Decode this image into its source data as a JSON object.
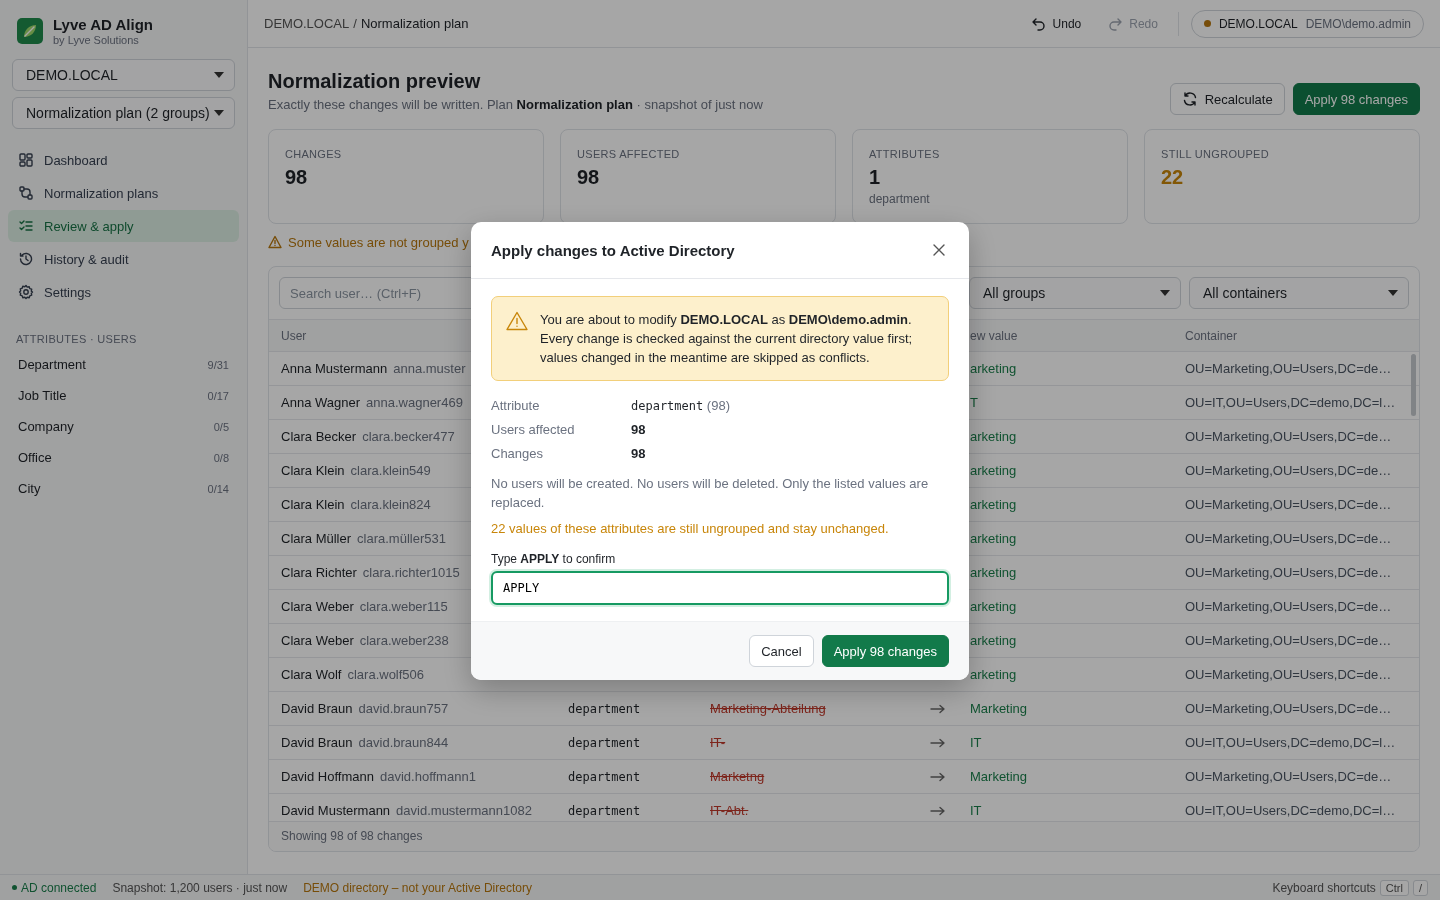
{
  "sidebar": {
    "app_name": "Lyve AD Align",
    "app_subtitle": "by Lyve Solutions",
    "domain_select": {
      "value": "DEMO.LOCAL"
    },
    "plan_select": {
      "value": "Normalization plan (2 groups)"
    },
    "nav_items": [
      {
        "label": "Dashboard",
        "selected": false
      },
      {
        "label": "Normalization plans",
        "selected": false
      },
      {
        "label": "Review & apply",
        "selected": true
      },
      {
        "label": "History & audit",
        "selected": false
      },
      {
        "label": "Settings",
        "selected": false
      }
    ],
    "section_title": "ATTRIBUTES · USERS",
    "attributes": [
      {
        "label": "Department",
        "count": "9/31"
      },
      {
        "label": "Job Title",
        "count": "0/17"
      },
      {
        "label": "Company",
        "count": "0/5"
      },
      {
        "label": "Office",
        "count": "0/8"
      },
      {
        "label": "City",
        "count": "0/14"
      }
    ]
  },
  "topbar": {
    "breadcrumb": [
      {
        "label": "DEMO.LOCAL"
      },
      {
        "label": "Normalization plan"
      }
    ],
    "separator": "/",
    "undo": {
      "label": "Undo",
      "disabled": false
    },
    "redo": {
      "label": "Redo",
      "disabled": true
    },
    "connection": {
      "color": "#774d09",
      "domain": "DEMO.LOCAL",
      "user": "DEMO\\demo.admin"
    }
  },
  "page": {
    "title": "Normalization preview",
    "subtitle": "Exactly these changes will be written. Plan **Normalization plan** · snapshot of just now",
    "buttons": [
      {
        "label": "Recalculate",
        "kind": "secondary"
      },
      {
        "label": "Apply 98 changes",
        "kind": "primary"
      }
    ]
  },
  "stats": [
    {
      "label": "CHANGES",
      "value": "98",
      "kind": "default"
    },
    {
      "label": "USERS AFFECTED",
      "value": "98",
      "kind": "default"
    },
    {
      "label": "ATTRIBUTES",
      "value": "1",
      "kind": "default",
      "note": "department"
    },
    {
      "label": "STILL UNGROUPED",
      "value": "22",
      "kind": "warning"
    }
  ],
  "warning_line": "Some values are not grouped y",
  "table": {
    "search": {
      "placeholder": "Search user… (Ctrl+F)"
    },
    "filters": [
      {
        "value": "All groups"
      },
      {
        "value": "All containers"
      }
    ],
    "columns": [
      {
        "label": "User",
        "kind": "user"
      },
      {
        "label": "ew value",
        "kind": "new"
      },
      {
        "label": "Container",
        "kind": "container"
      }
    ],
    "rows": [
      {
        "name": "Anna Mustermann",
        "login": "anna.muster",
        "new_value": "arketing",
        "container": "OU=Marketing,OU=Users,DC=de…"
      },
      {
        "name": "Anna Wagner",
        "login": "anna.wagner469",
        "new_value": "T",
        "container": "OU=IT,OU=Users,DC=demo,DC=l…"
      },
      {
        "name": "Clara Becker",
        "login": "clara.becker477",
        "new_value": "arketing",
        "container": "OU=Marketing,OU=Users,DC=de…"
      },
      {
        "name": "Clara Klein",
        "login": "clara.klein549",
        "new_value": "arketing",
        "container": "OU=Marketing,OU=Users,DC=de…"
      },
      {
        "name": "Clara Klein",
        "login": "clara.klein824",
        "new_value": "arketing",
        "container": "OU=Marketing,OU=Users,DC=de…"
      },
      {
        "name": "Clara Müller",
        "login": "clara.müller531",
        "new_value": "arketing",
        "container": "OU=Marketing,OU=Users,DC=de…"
      },
      {
        "name": "Clara Richter",
        "login": "clara.richter1015",
        "new_value": "arketing",
        "container": "OU=Marketing,OU=Users,DC=de…"
      },
      {
        "name": "Clara Weber",
        "login": "clara.weber115",
        "new_value": "arketing",
        "container": "OU=Marketing,OU=Users,DC=de…"
      },
      {
        "name": "Clara Weber",
        "login": "clara.weber238",
        "new_value": "arketing",
        "container": "OU=Marketing,OU=Users,DC=de…"
      },
      {
        "name": "Clara Wolf",
        "login": "clara.wolf506",
        "new_value": "arketing",
        "container": "OU=Marketing,OU=Users,DC=de…"
      },
      {
        "name": "David Braun",
        "login": "david.braun757",
        "attribute": "department",
        "old_value": "Marketing-Abteilung",
        "new_value": "Marketing",
        "container": "OU=Marketing,OU=Users,DC=de…"
      },
      {
        "name": "David Braun",
        "login": "david.braun844",
        "attribute": "department",
        "old_value": "IT-",
        "new_value": "IT",
        "container": "OU=IT,OU=Users,DC=demo,DC=l…"
      },
      {
        "name": "David Hoffmann",
        "login": "david.hoffmann1",
        "attribute": "department",
        "old_value": "Marketng",
        "new_value": "Marketing",
        "container": "OU=Marketing,OU=Users,DC=de…"
      },
      {
        "name": "David Mustermann",
        "login": "david.mustermann1082",
        "attribute": "department",
        "old_value": "IT-Abt.",
        "new_value": "IT",
        "container": "OU=IT,OU=Users,DC=demo,DC=l…"
      }
    ],
    "footer": "Showing 98 of 98 changes"
  },
  "status_bar": {
    "connection": {
      "label": "AD connected",
      "connected": true
    },
    "snapshot": "Snapshot: 1,200 users · just now",
    "demo_note": "DEMO directory – not your Active Directory",
    "shortcuts_label": "Keyboard shortcuts",
    "keys": [
      "Ctrl",
      "/"
    ]
  },
  "dialog": {
    "title": "Apply changes to Active Directory",
    "warning": "You are about to modify **DEMO.LOCAL** as **DEMO\\demo.admin**. Every change is checked against the current directory value first; values changed in the meantime are skipped as conflicts.",
    "facts": [
      {
        "label": "Attribute",
        "value": "department",
        "note": "(98)",
        "kind": "code"
      },
      {
        "label": "Users affected",
        "value": "98",
        "kind": "strong"
      },
      {
        "label": "Changes",
        "value": "98",
        "kind": "strong"
      }
    ],
    "info": "No users will be created. No users will be deleted. Only the listed values are replaced.",
    "ungrouped_note": "22 values of these attributes are still ungrouped and stay unchanged.",
    "confirm_label": "Type **APPLY** to confirm",
    "confirm_input": {
      "value": "APPLY"
    },
    "buttons": [
      {
        "label": "Cancel",
        "kind": "secondary"
      },
      {
        "label": "Apply 98 changes",
        "kind": "primary"
      }
    ]
  }
}
